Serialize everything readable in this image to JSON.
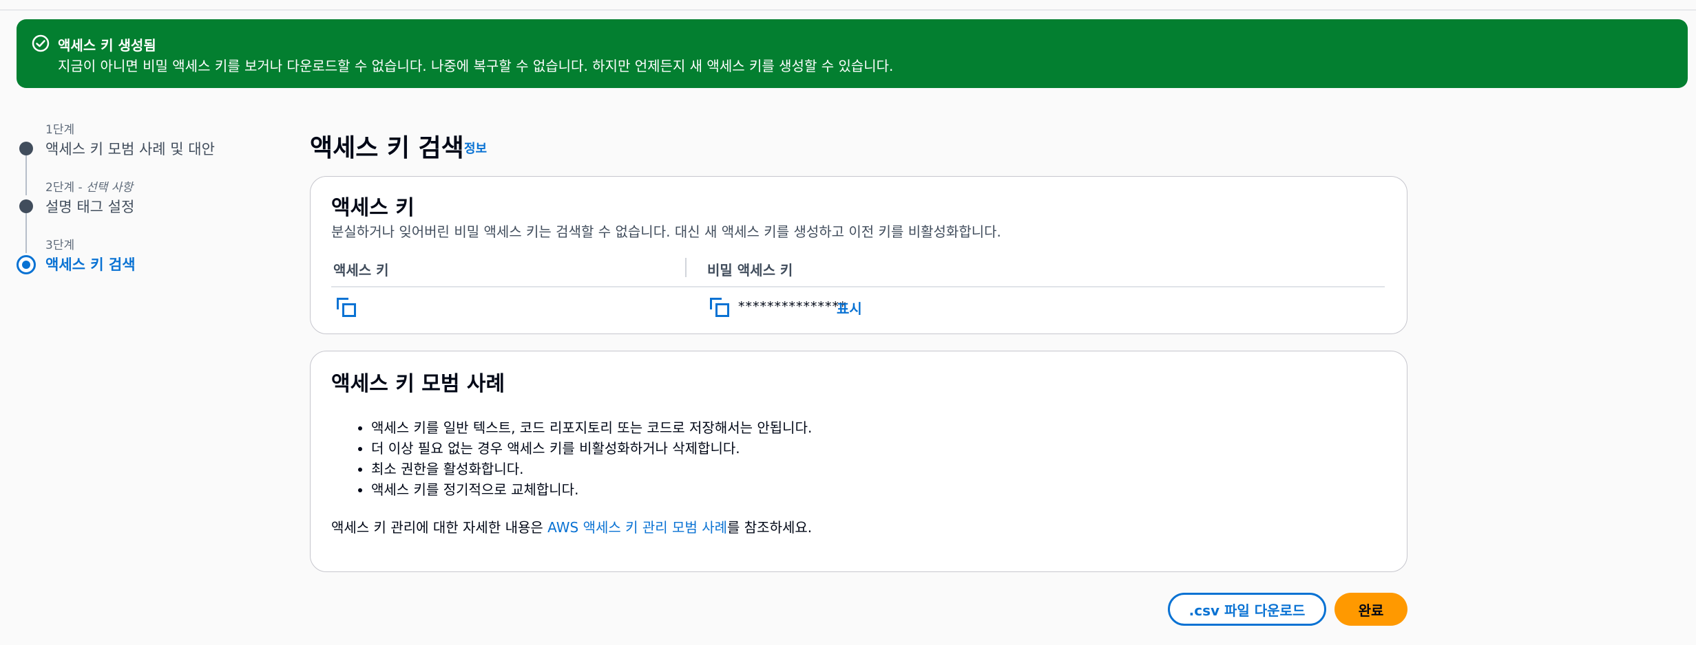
{
  "flash": {
    "title": "액세스 키 생성됨",
    "message": "지금이 아니면 비밀 액세스 키를 보거나 다운로드할 수 없습니다. 나중에 복구할 수 없습니다. 하지만 언제든지 새 액세스 키를 생성할 수 있습니다.",
    "color": "#037f30",
    "icon": "success-circle-icon"
  },
  "steps": [
    {
      "number": "1단계",
      "label": "액세스 키 모범 사례 및 대안"
    },
    {
      "number": "2단계 - ",
      "optional": "선택 사항",
      "label": "설명 태그 설정"
    },
    {
      "number": "3단계",
      "label": "액세스 키 검색",
      "active": true
    }
  ],
  "page": {
    "title": "액세스 키 검색",
    "info_link": "정보"
  },
  "access_keys": {
    "title": "액세스 키",
    "description": "분실하거나 잊어버린 비밀 액세스 키는 검색할 수 없습니다. 대신 새 액세스 키를 생성하고 이전 키를 비활성화합니다.",
    "col_access_key": "액세스 키",
    "col_secret_key": "비밀 액세스 키",
    "secret_masked": "***************",
    "show_label": "표시"
  },
  "best_practices": {
    "title": "액세스 키 모범 사례",
    "items": [
      "액세스 키를 일반 텍스트, 코드 리포지토리 또는 코드로 저장해서는 안됩니다.",
      "더 이상 필요 없는 경우 액세스 키를 비활성화하거나 삭제합니다.",
      "최소 권한을 활성화합니다.",
      "액세스 키를 정기적으로 교체합니다."
    ],
    "note_prefix": "액세스 키 관리에 대한 자세한 내용은 ",
    "note_link": "AWS 액세스 키 관리 모범 사례",
    "note_suffix": "를 참조하세요."
  },
  "actions": {
    "download_csv": ".csv 파일 다운로드",
    "done": "완료"
  },
  "colors": {
    "primary_blue": "#0972d3",
    "cta_orange": "#ff9900"
  }
}
